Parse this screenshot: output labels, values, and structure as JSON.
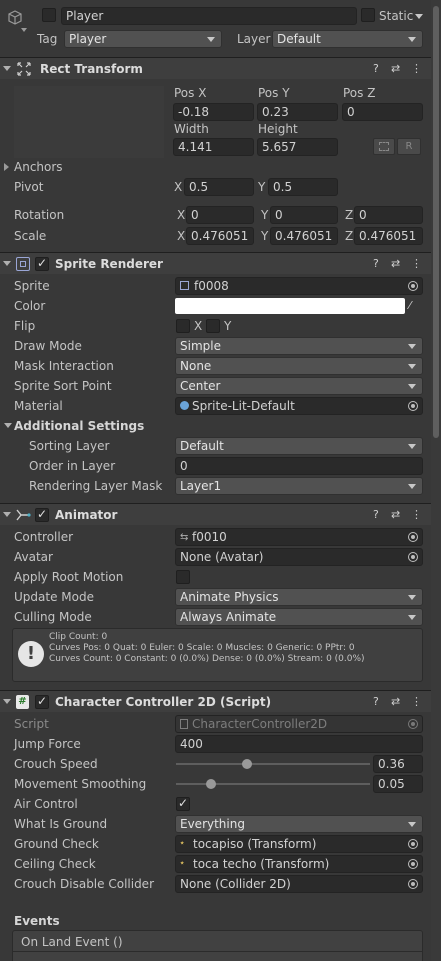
{
  "header": {
    "name": "Player",
    "static_label": "Static",
    "tag_label": "Tag",
    "tag_value": "Player",
    "layer_label": "Layer",
    "layer_value": "Default"
  },
  "rect_transform": {
    "title": "Rect Transform",
    "pos_x_label": "Pos X",
    "pos_y_label": "Pos Y",
    "pos_z_label": "Pos Z",
    "pos_x": "-0.18",
    "pos_y": "0.23",
    "pos_z": "0",
    "width_label": "Width",
    "height_label": "Height",
    "width": "4.141",
    "height": "5.657",
    "r_button": "R",
    "anchors_label": "Anchors",
    "pivot_label": "Pivot",
    "pivot_x": "0.5",
    "pivot_y": "0.5",
    "rotation_label": "Rotation",
    "rot_x": "0",
    "rot_y": "0",
    "rot_z": "0",
    "scale_label": "Scale",
    "scale_x": "0.476051",
    "scale_y": "0.476051",
    "scale_z": "0.476051",
    "x": "X",
    "y": "Y",
    "z": "Z"
  },
  "sprite_renderer": {
    "title": "Sprite Renderer",
    "sprite_label": "Sprite",
    "sprite_value": "f0008",
    "color_label": "Color",
    "color_value": "#ffffff",
    "flip_label": "Flip",
    "flip_x": "X",
    "flip_y": "Y",
    "draw_mode_label": "Draw Mode",
    "draw_mode_value": "Simple",
    "mask_label": "Mask Interaction",
    "mask_value": "None",
    "sort_point_label": "Sprite Sort Point",
    "sort_point_value": "Center",
    "material_label": "Material",
    "material_value": "Sprite-Lit-Default",
    "additional_label": "Additional Settings",
    "sorting_layer_label": "Sorting Layer",
    "sorting_layer_value": "Default",
    "order_label": "Order in Layer",
    "order_value": "0",
    "rendering_mask_label": "Rendering Layer Mask",
    "rendering_mask_value": "Layer1"
  },
  "animator": {
    "title": "Animator",
    "controller_label": "Controller",
    "controller_value": "f0010",
    "avatar_label": "Avatar",
    "avatar_value": "None (Avatar)",
    "root_motion_label": "Apply Root Motion",
    "update_mode_label": "Update Mode",
    "update_mode_value": "Animate Physics",
    "culling_label": "Culling Mode",
    "culling_value": "Always Animate",
    "info_line1": "Clip Count: 0",
    "info_line2": "Curves Pos: 0 Quat: 0 Euler: 0 Scale: 0 Muscles: 0 Generic: 0 PPtr: 0",
    "info_line3": "Curves Count: 0 Constant: 0 (0.0%) Dense: 0 (0.0%) Stream: 0 (0.0%)"
  },
  "character_controller": {
    "title": "Character Controller 2D (Script)",
    "script_label": "Script",
    "script_value": "CharacterController2D",
    "jump_label": "Jump Force",
    "jump_value": "400",
    "crouch_speed_label": "Crouch Speed",
    "crouch_speed_value": "0.36",
    "movement_label": "Movement Smoothing",
    "movement_value": "0.05",
    "air_label": "Air Control",
    "ground_label": "What Is Ground",
    "ground_value": "Everything",
    "ground_check_label": "Ground Check",
    "ground_check_value": "tocapiso (Transform)",
    "ceiling_label": "Ceiling Check",
    "ceiling_value": "toca techo (Transform)",
    "crouch_collider_label": "Crouch Disable Collider",
    "crouch_collider_value": "None (Collider 2D)",
    "events_label": "Events",
    "on_land_label": "On Land Event ()"
  }
}
